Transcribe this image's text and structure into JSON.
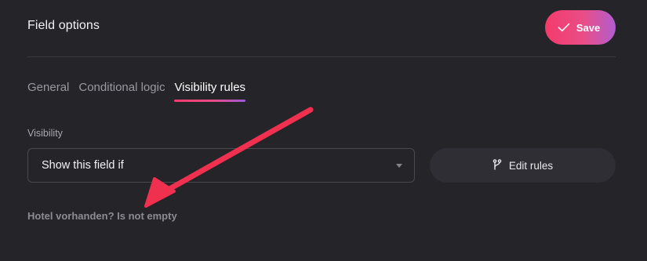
{
  "header": {
    "title": "Field options",
    "save_label": "Save"
  },
  "tabs": [
    {
      "label": "General",
      "active": false
    },
    {
      "label": "Conditional logic",
      "active": false
    },
    {
      "label": "Visibility rules",
      "active": true
    }
  ],
  "visibility": {
    "label": "Visibility",
    "selected": "Show this field if",
    "edit_label": "Edit rules",
    "rule_summary": "Hotel vorhanden? Is not empty"
  },
  "colors": {
    "background": "#252429",
    "accent_start": "#f43b6b",
    "accent_end": "#b15ed0",
    "annotation_arrow": "#f0304f"
  }
}
